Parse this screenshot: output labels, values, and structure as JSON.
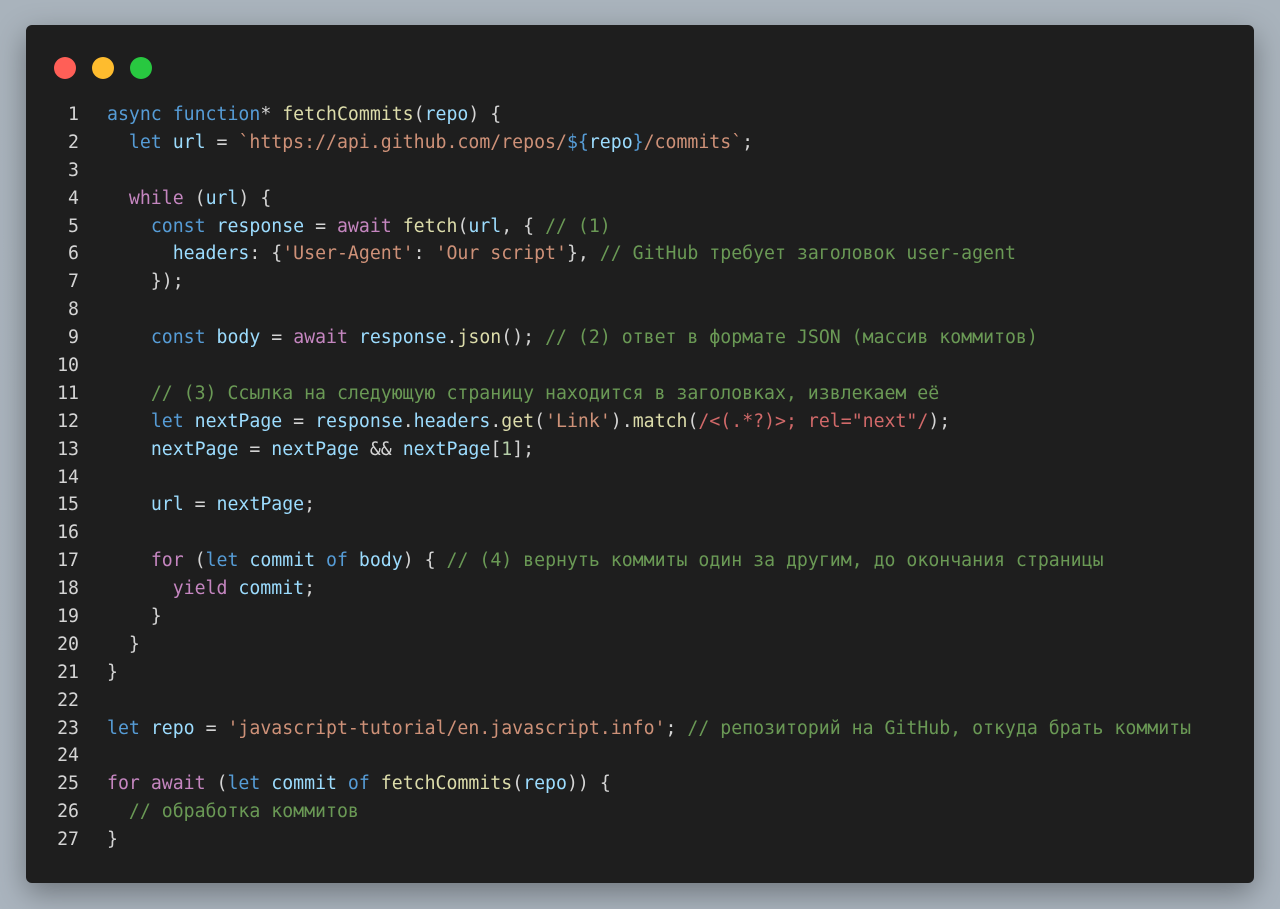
{
  "window": {
    "controls": [
      {
        "name": "close",
        "color": "#ff5f57"
      },
      {
        "name": "minimize",
        "color": "#febc2e"
      },
      {
        "name": "maximize",
        "color": "#28c840"
      }
    ]
  },
  "code": {
    "lines": [
      {
        "n": "1",
        "tokens": [
          [
            "kw",
            "async "
          ],
          [
            "kw",
            "function"
          ],
          [
            "p",
            "* "
          ],
          [
            "fn",
            "fetchCommits"
          ],
          [
            "p",
            "("
          ],
          [
            "var",
            "repo"
          ],
          [
            "p",
            ") {"
          ]
        ]
      },
      {
        "n": "2",
        "tokens": [
          [
            "p",
            "  "
          ],
          [
            "kw",
            "let "
          ],
          [
            "var",
            "url"
          ],
          [
            "p",
            " = "
          ],
          [
            "str",
            "`https://api.github.com/repos/"
          ],
          [
            "kw",
            "${"
          ],
          [
            "var",
            "repo"
          ],
          [
            "kw",
            "}"
          ],
          [
            "str",
            "/commits`"
          ],
          [
            "p",
            ";"
          ]
        ]
      },
      {
        "n": "3",
        "tokens": []
      },
      {
        "n": "4",
        "tokens": [
          [
            "p",
            "  "
          ],
          [
            "ctl",
            "while"
          ],
          [
            "p",
            " ("
          ],
          [
            "var",
            "url"
          ],
          [
            "p",
            ") {"
          ]
        ]
      },
      {
        "n": "5",
        "tokens": [
          [
            "p",
            "    "
          ],
          [
            "kw",
            "const "
          ],
          [
            "var",
            "response"
          ],
          [
            "p",
            " = "
          ],
          [
            "ctl",
            "await "
          ],
          [
            "fn",
            "fetch"
          ],
          [
            "p",
            "("
          ],
          [
            "var",
            "url"
          ],
          [
            "p",
            ", { "
          ],
          [
            "cm",
            "// (1)"
          ]
        ]
      },
      {
        "n": "6",
        "tokens": [
          [
            "p",
            "      "
          ],
          [
            "var",
            "headers"
          ],
          [
            "p",
            ": {"
          ],
          [
            "str",
            "'User-Agent'"
          ],
          [
            "p",
            ": "
          ],
          [
            "str",
            "'Our script'"
          ],
          [
            "p",
            "}, "
          ],
          [
            "cm",
            "// GitHub требует заголовок user-agent"
          ]
        ]
      },
      {
        "n": "7",
        "tokens": [
          [
            "p",
            "    });"
          ]
        ]
      },
      {
        "n": "8",
        "tokens": []
      },
      {
        "n": "9",
        "tokens": [
          [
            "p",
            "    "
          ],
          [
            "kw",
            "const "
          ],
          [
            "var",
            "body"
          ],
          [
            "p",
            " = "
          ],
          [
            "ctl",
            "await "
          ],
          [
            "var",
            "response"
          ],
          [
            "p",
            "."
          ],
          [
            "fn",
            "json"
          ],
          [
            "p",
            "(); "
          ],
          [
            "cm",
            "// (2) ответ в формате JSON (массив коммитов)"
          ]
        ]
      },
      {
        "n": "10",
        "tokens": []
      },
      {
        "n": "11",
        "tokens": [
          [
            "p",
            "    "
          ],
          [
            "cm",
            "// (3) Ссылка на следующую страницу находится в заголовках, извлекаем её"
          ]
        ]
      },
      {
        "n": "12",
        "tokens": [
          [
            "p",
            "    "
          ],
          [
            "kw",
            "let "
          ],
          [
            "var",
            "nextPage"
          ],
          [
            "p",
            " = "
          ],
          [
            "var",
            "response"
          ],
          [
            "p",
            "."
          ],
          [
            "var",
            "headers"
          ],
          [
            "p",
            "."
          ],
          [
            "fn",
            "get"
          ],
          [
            "p",
            "("
          ],
          [
            "str",
            "'Link'"
          ],
          [
            "p",
            ")."
          ],
          [
            "fn",
            "match"
          ],
          [
            "p",
            "("
          ],
          [
            "re",
            "/<(.*?)>; rel=\"next\"/"
          ],
          [
            "p",
            ");"
          ]
        ]
      },
      {
        "n": "13",
        "tokens": [
          [
            "p",
            "    "
          ],
          [
            "var",
            "nextPage"
          ],
          [
            "p",
            " = "
          ],
          [
            "var",
            "nextPage"
          ],
          [
            "p",
            " && "
          ],
          [
            "var",
            "nextPage"
          ],
          [
            "p",
            "["
          ],
          [
            "num",
            "1"
          ],
          [
            "p",
            "];"
          ]
        ]
      },
      {
        "n": "14",
        "tokens": []
      },
      {
        "n": "15",
        "tokens": [
          [
            "p",
            "    "
          ],
          [
            "var",
            "url"
          ],
          [
            "p",
            " = "
          ],
          [
            "var",
            "nextPage"
          ],
          [
            "p",
            ";"
          ]
        ]
      },
      {
        "n": "16",
        "tokens": []
      },
      {
        "n": "17",
        "tokens": [
          [
            "p",
            "    "
          ],
          [
            "ctl",
            "for"
          ],
          [
            "p",
            " ("
          ],
          [
            "kw",
            "let "
          ],
          [
            "var",
            "commit"
          ],
          [
            "kw",
            " of "
          ],
          [
            "var",
            "body"
          ],
          [
            "p",
            ") { "
          ],
          [
            "cm",
            "// (4) вернуть коммиты один за другим, до окончания страницы"
          ]
        ]
      },
      {
        "n": "18",
        "tokens": [
          [
            "p",
            "      "
          ],
          [
            "ctl",
            "yield "
          ],
          [
            "var",
            "commit"
          ],
          [
            "p",
            ";"
          ]
        ]
      },
      {
        "n": "19",
        "tokens": [
          [
            "p",
            "    }"
          ]
        ]
      },
      {
        "n": "20",
        "tokens": [
          [
            "p",
            "  }"
          ]
        ]
      },
      {
        "n": "21",
        "tokens": [
          [
            "p",
            "}"
          ]
        ]
      },
      {
        "n": "22",
        "tokens": []
      },
      {
        "n": "23",
        "tokens": [
          [
            "kw",
            "let "
          ],
          [
            "var",
            "repo"
          ],
          [
            "p",
            " = "
          ],
          [
            "str",
            "'javascript-tutorial/en.javascript.info'"
          ],
          [
            "p",
            "; "
          ],
          [
            "cm",
            "// репозиторий на GitHub, откуда брать коммиты"
          ]
        ]
      },
      {
        "n": "24",
        "tokens": []
      },
      {
        "n": "25",
        "tokens": [
          [
            "ctl",
            "for "
          ],
          [
            "ctl",
            "await"
          ],
          [
            "p",
            " ("
          ],
          [
            "kw",
            "let "
          ],
          [
            "var",
            "commit"
          ],
          [
            "kw",
            " of "
          ],
          [
            "fn",
            "fetchCommits"
          ],
          [
            "p",
            "("
          ],
          [
            "var",
            "repo"
          ],
          [
            "p",
            ")) {"
          ]
        ]
      },
      {
        "n": "26",
        "tokens": [
          [
            "p",
            "  "
          ],
          [
            "cm",
            "// обработка коммитов"
          ]
        ]
      },
      {
        "n": "27",
        "tokens": [
          [
            "p",
            "}"
          ]
        ]
      }
    ]
  }
}
